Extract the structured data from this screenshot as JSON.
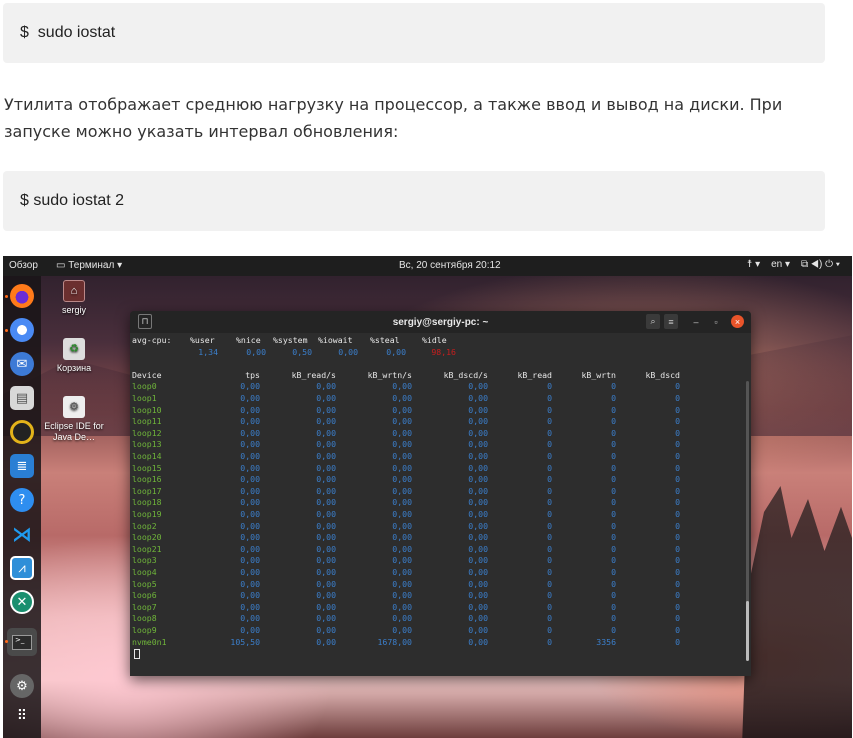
{
  "article": {
    "code1": "$  sudo iostat",
    "paragraph": "Утилита отображает среднюю нагрузку на процессор, а также ввод и вывод на диски. При запуске можно указать интервал обновления:",
    "code2": "$ sudo iostat 2"
  },
  "desktop": {
    "topbar": {
      "overview": "Обзор",
      "app_menu": "Терминал",
      "clock": "Вс, 20 сентября  20:12",
      "lang": "en"
    },
    "desktop_icons": [
      {
        "label": "sergiy"
      },
      {
        "label": "Корзина"
      },
      {
        "label": "Eclipse IDE for Java De…"
      }
    ],
    "dock": [
      {
        "name": "firefox",
        "color": "#ff7a1a"
      },
      {
        "name": "chrome",
        "color": "#4a8af4"
      },
      {
        "name": "thunderbird",
        "color": "#3d7ad6"
      },
      {
        "name": "files",
        "color": "#c9c9c9"
      },
      {
        "name": "rhythmbox",
        "color": "#e3b31a"
      },
      {
        "name": "libreoffice-writer",
        "color": "#2a7fd4"
      },
      {
        "name": "help",
        "color": "#2e8ef0"
      },
      {
        "name": "vscode",
        "color": "#1f9bf0"
      },
      {
        "name": "system-monitor",
        "color": "#2f8fd8"
      },
      {
        "name": "app-center",
        "color": "#1a8f6f"
      },
      {
        "name": "terminal",
        "color": "#3a3a3a"
      },
      {
        "name": "settings",
        "color": "#777"
      },
      {
        "name": "show-apps",
        "color": "#444"
      }
    ]
  },
  "terminal": {
    "title": "sergiy@sergiy-pc: ~",
    "cpu_header": [
      "avg-cpu:",
      "%user",
      "%nice",
      "%system",
      "%iowait",
      "%steal",
      "%idle"
    ],
    "cpu_values": [
      "1,34",
      "0,00",
      "0,50",
      "0,00",
      "0,00",
      "98,16"
    ],
    "dev_header": [
      "Device",
      "tps",
      "kB_read/s",
      "kB_wrtn/s",
      "kB_dscd/s",
      "kB_read",
      "kB_wrtn",
      "kB_dscd"
    ],
    "rows": [
      [
        "loop0",
        "0,00",
        "0,00",
        "0,00",
        "0,00",
        "0",
        "0",
        "0"
      ],
      [
        "loop1",
        "0,00",
        "0,00",
        "0,00",
        "0,00",
        "0",
        "0",
        "0"
      ],
      [
        "loop10",
        "0,00",
        "0,00",
        "0,00",
        "0,00",
        "0",
        "0",
        "0"
      ],
      [
        "loop11",
        "0,00",
        "0,00",
        "0,00",
        "0,00",
        "0",
        "0",
        "0"
      ],
      [
        "loop12",
        "0,00",
        "0,00",
        "0,00",
        "0,00",
        "0",
        "0",
        "0"
      ],
      [
        "loop13",
        "0,00",
        "0,00",
        "0,00",
        "0,00",
        "0",
        "0",
        "0"
      ],
      [
        "loop14",
        "0,00",
        "0,00",
        "0,00",
        "0,00",
        "0",
        "0",
        "0"
      ],
      [
        "loop15",
        "0,00",
        "0,00",
        "0,00",
        "0,00",
        "0",
        "0",
        "0"
      ],
      [
        "loop16",
        "0,00",
        "0,00",
        "0,00",
        "0,00",
        "0",
        "0",
        "0"
      ],
      [
        "loop17",
        "0,00",
        "0,00",
        "0,00",
        "0,00",
        "0",
        "0",
        "0"
      ],
      [
        "loop18",
        "0,00",
        "0,00",
        "0,00",
        "0,00",
        "0",
        "0",
        "0"
      ],
      [
        "loop19",
        "0,00",
        "0,00",
        "0,00",
        "0,00",
        "0",
        "0",
        "0"
      ],
      [
        "loop2",
        "0,00",
        "0,00",
        "0,00",
        "0,00",
        "0",
        "0",
        "0"
      ],
      [
        "loop20",
        "0,00",
        "0,00",
        "0,00",
        "0,00",
        "0",
        "0",
        "0"
      ],
      [
        "loop21",
        "0,00",
        "0,00",
        "0,00",
        "0,00",
        "0",
        "0",
        "0"
      ],
      [
        "loop3",
        "0,00",
        "0,00",
        "0,00",
        "0,00",
        "0",
        "0",
        "0"
      ],
      [
        "loop4",
        "0,00",
        "0,00",
        "0,00",
        "0,00",
        "0",
        "0",
        "0"
      ],
      [
        "loop5",
        "0,00",
        "0,00",
        "0,00",
        "0,00",
        "0",
        "0",
        "0"
      ],
      [
        "loop6",
        "0,00",
        "0,00",
        "0,00",
        "0,00",
        "0",
        "0",
        "0"
      ],
      [
        "loop7",
        "0,00",
        "0,00",
        "0,00",
        "0,00",
        "0",
        "0",
        "0"
      ],
      [
        "loop8",
        "0,00",
        "0,00",
        "0,00",
        "0,00",
        "0",
        "0",
        "0"
      ],
      [
        "loop9",
        "0,00",
        "0,00",
        "0,00",
        "0,00",
        "0",
        "0",
        "0"
      ],
      [
        "nvme0n1",
        "105,50",
        "0,00",
        "1678,00",
        "0,00",
        "0",
        "3356",
        "0"
      ]
    ]
  }
}
